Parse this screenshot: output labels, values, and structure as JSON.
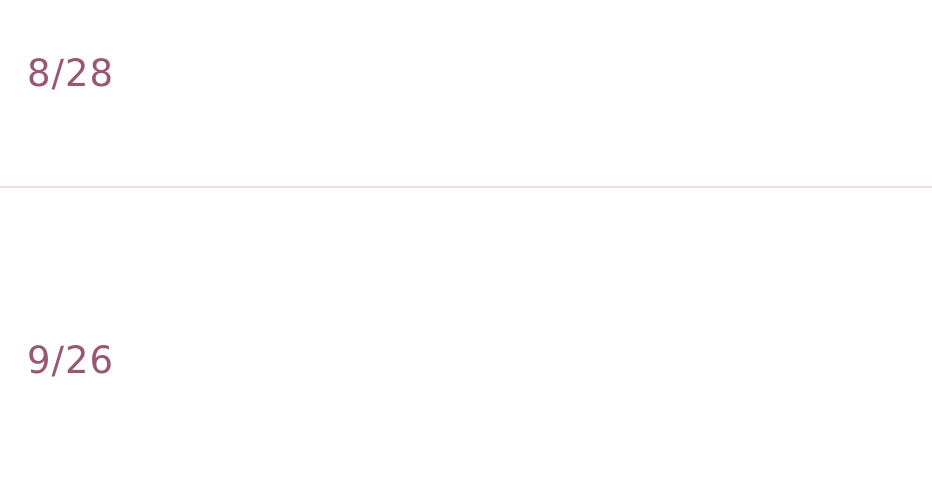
{
  "colors": {
    "date_text": "#9a5773",
    "divider": "#f3d6f4",
    "background": "#ffffff"
  },
  "rows": [
    {
      "date": "8/28"
    },
    {
      "date": "9/26"
    }
  ]
}
